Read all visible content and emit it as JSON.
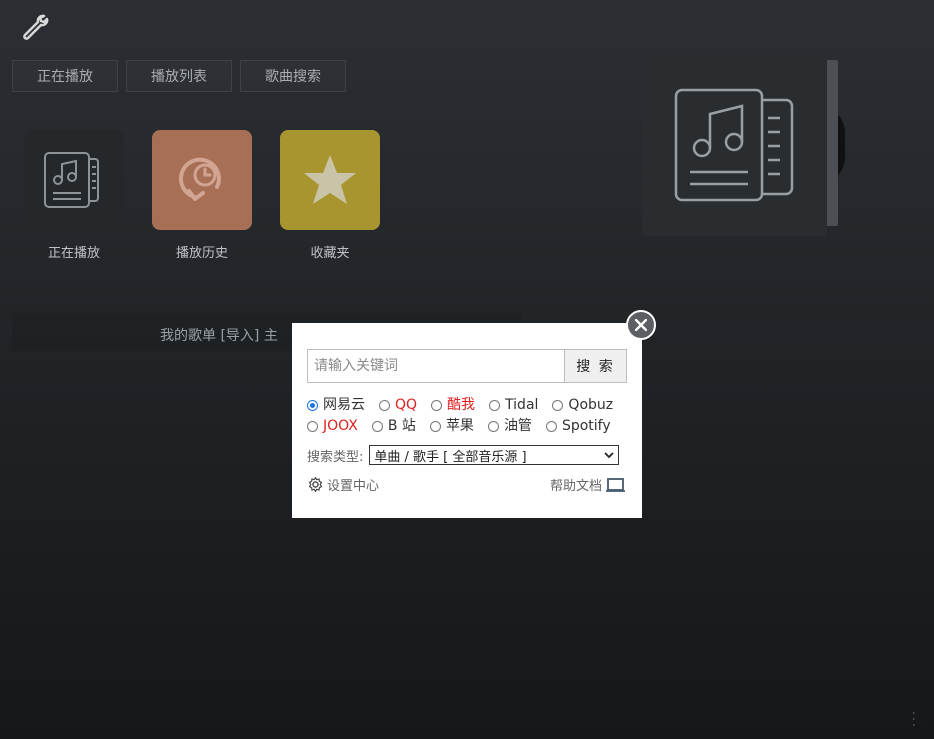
{
  "tabs": [
    "正在播放",
    "播放列表",
    "歌曲搜索"
  ],
  "tiles": [
    {
      "label": "正在播放",
      "icon": "music-doc-icon",
      "color": "#24282b"
    },
    {
      "label": "播放历史",
      "icon": "history-icon",
      "color": "#a86f57"
    },
    {
      "label": "收藏夹",
      "icon": "star-icon",
      "color": "#a8952f"
    }
  ],
  "my_lists": {
    "text": "我的歌单 [导入]   主"
  },
  "dialog": {
    "search_placeholder": "请输入关键词",
    "search_button": "搜 索",
    "sources_row1": [
      "网易云",
      "QQ",
      "酷我",
      "Tidal",
      "Qobuz"
    ],
    "sources_row2": [
      "JOOX",
      "B 站",
      "苹果",
      "油管",
      "Spotify"
    ],
    "selected_source": "网易云",
    "search_type_label": "搜索类型:",
    "search_type_value": "单曲 / 歌手 [ 全部音乐源 ]",
    "settings_label": "设置中心",
    "help_label": "帮助文档"
  },
  "colors": {
    "accent_red": "#e02020",
    "radio_blue": "#1a73e8"
  }
}
